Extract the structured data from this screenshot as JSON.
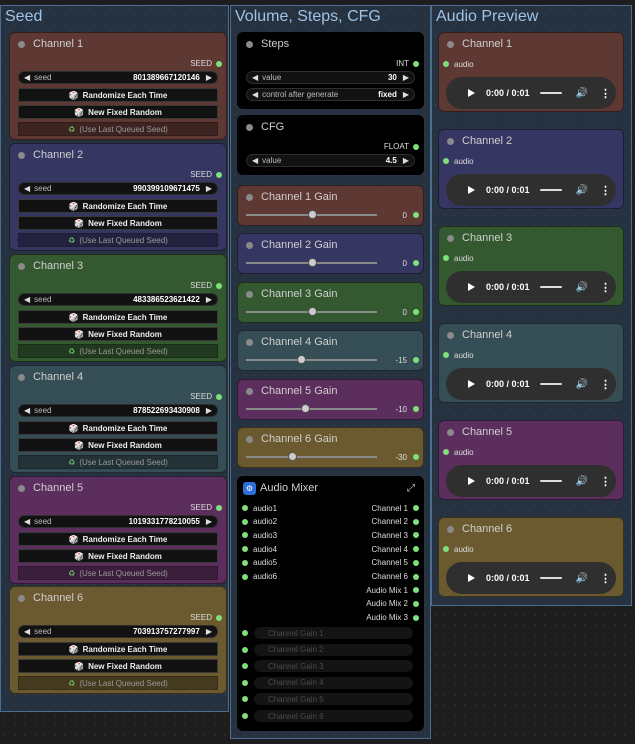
{
  "groups": [
    {
      "title": "Seed"
    },
    {
      "title": "Volume, Steps, CFG"
    },
    {
      "title": "Audio Preview"
    }
  ],
  "seed_nodes": [
    {
      "title": "Channel 1",
      "seed": "801389667120146",
      "color": "#5e3833"
    },
    {
      "title": "Channel 2",
      "seed": "990399109671475",
      "color": "#363662"
    },
    {
      "title": "Channel 3",
      "seed": "483386523621422",
      "color": "#34582f"
    },
    {
      "title": "Channel 4",
      "seed": "878522693430908",
      "color": "#354d54"
    },
    {
      "title": "Channel 5",
      "seed": "1019331778210055",
      "color": "#5b2e5d"
    },
    {
      "title": "Channel 6",
      "seed": "703913757277997",
      "color": "#6b5a2f"
    }
  ],
  "seed_common": {
    "output_label": "SEED",
    "seed_label": "seed",
    "randomize_label": "Randomize Each Time",
    "new_fixed_label": "New Fixed Random",
    "last_queued_label": "(Use Last Queued Seed)",
    "dice_icon": "🎲",
    "recycle_icon": "♻"
  },
  "steps_node": {
    "title": "Steps",
    "output_label": "INT",
    "value_label": "value",
    "value": "30",
    "control_label": "control after generate",
    "control_value": "fixed"
  },
  "cfg_node": {
    "title": "CFG",
    "output_label": "FLOAT",
    "value_label": "value",
    "value": "4.5"
  },
  "gain_nodes": [
    {
      "title": "Channel 1 Gain",
      "value": "0",
      "fraction": 0.5,
      "color": "#5e3833"
    },
    {
      "title": "Channel 2 Gain",
      "value": "0",
      "fraction": 0.5,
      "color": "#363662"
    },
    {
      "title": "Channel 3 Gain",
      "value": "0",
      "fraction": 0.5,
      "color": "#34582f"
    },
    {
      "title": "Channel 4 Gain",
      "value": "-15",
      "fraction": 0.42,
      "color": "#354d54"
    },
    {
      "title": "Channel 5 Gain",
      "value": "-10",
      "fraction": 0.45,
      "color": "#5b2e5d"
    },
    {
      "title": "Channel 6 Gain",
      "value": "-30",
      "fraction": 0.35,
      "color": "#6b5a2f"
    }
  ],
  "mixer": {
    "title": "Audio Mixer",
    "inputs": [
      "audio1",
      "audio2",
      "audio3",
      "audio4",
      "audio5",
      "audio6"
    ],
    "outputs": [
      "Channel 1",
      "Channel 2",
      "Channel 3",
      "Channel 4",
      "Channel 5",
      "Channel 6",
      "Audio Mix 1",
      "Audio Mix 2",
      "Audio Mix 3"
    ],
    "gain_inputs": [
      "Channel Gain 1",
      "Channel Gain 2",
      "Channel Gain 3",
      "Channel Gain 4",
      "Channel Gain 5",
      "Channel Gain 6"
    ]
  },
  "preview_nodes": [
    {
      "title": "Channel 1",
      "color": "#5e3833"
    },
    {
      "title": "Channel 2",
      "color": "#363662"
    },
    {
      "title": "Channel 3",
      "color": "#34582f"
    },
    {
      "title": "Channel 4",
      "color": "#354d54"
    },
    {
      "title": "Channel 5",
      "color": "#5b2e5d"
    },
    {
      "title": "Channel 6",
      "color": "#6b5a2f"
    }
  ],
  "preview_common": {
    "input_label": "audio",
    "time": "0:00 / 0:01"
  }
}
